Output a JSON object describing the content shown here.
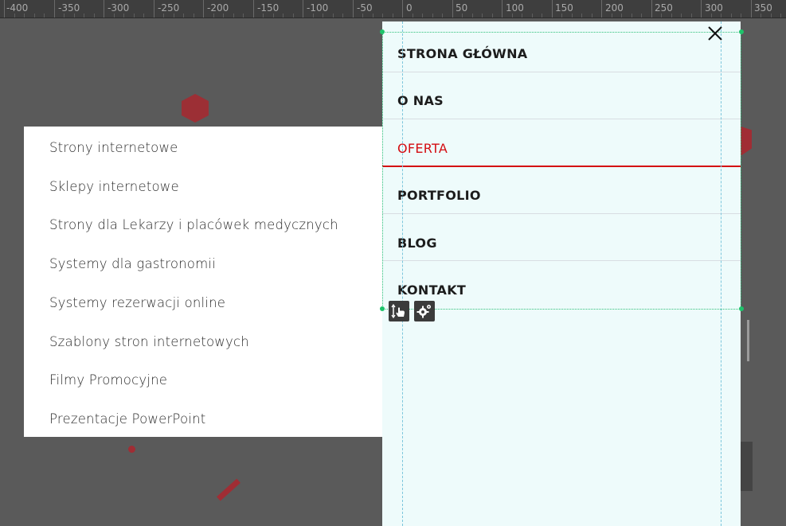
{
  "ruler": {
    "labels": [
      "-400",
      "-350",
      "-300",
      "-250",
      "-200",
      "-150",
      "-100",
      "-50",
      "0",
      "50",
      "100",
      "150",
      "200",
      "250",
      "300",
      "350"
    ]
  },
  "submenu": {
    "items": [
      "Strony internetowe",
      "Sklepy internetowe",
      "Strony dla Lekarzy i placówek medycznych",
      "Systemy dla gastronomii",
      "Systemy rezerwacji online",
      "Szablony stron internetowych",
      "Filmy Promocyjne",
      "Prezentacje PowerPoint"
    ]
  },
  "menu": {
    "items": [
      {
        "label": "STRONA GŁÓWNA",
        "active": false
      },
      {
        "label": "O NAS",
        "active": false
      },
      {
        "label": "OFERTA",
        "active": true
      },
      {
        "label": "PORTFOLIO",
        "active": false
      },
      {
        "label": "BLOG",
        "active": false
      },
      {
        "label": "KONTAKT",
        "active": false
      }
    ]
  },
  "colors": {
    "accent": "#d40d12",
    "panel_bg": "#eefbfb",
    "canvas_bg": "#5a5a5a"
  },
  "icons": {
    "close": "close-icon",
    "move": "move-hand-icon",
    "settings": "gear-icon"
  }
}
